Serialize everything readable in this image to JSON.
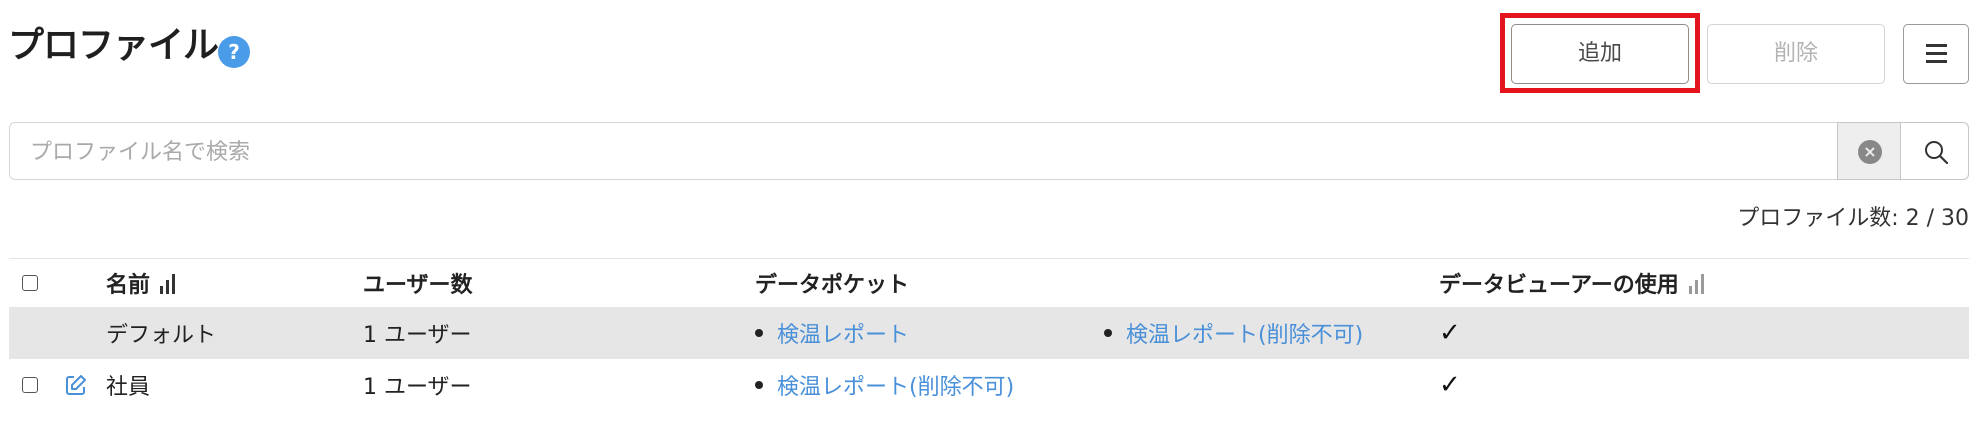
{
  "header": {
    "title": "プロファイル",
    "help_icon": "question-mark-icon",
    "add_label": "追加",
    "delete_label": "削除",
    "menu_icon": "hamburger-menu-icon",
    "highlight_color": "#e3141b"
  },
  "search": {
    "placeholder": "プロファイル名で検索",
    "value": "",
    "clear_icon": "clear-circle-x-icon",
    "search_icon": "magnifier-icon"
  },
  "profile_count": "プロファイル数: 2 / 30",
  "table": {
    "columns": {
      "name": "名前",
      "users": "ユーザー数",
      "data_pocket": "データポケット",
      "data_viewer": "データビューアーの使用"
    },
    "rows": [
      {
        "name": "デフォルト",
        "users": "1 ユーザー",
        "pocket_1": "検温レポート",
        "pocket_2": "検温レポート(削除不可)",
        "viewer": "✓",
        "selected": false
      },
      {
        "name": "社員",
        "users": "1 ユーザー",
        "pocket_1": "検温レポート(削除不可)",
        "viewer": "✓",
        "selected": false
      }
    ]
  },
  "colors": {
    "accent": "#4a9be8",
    "link": "#4a90d9",
    "row_highlight": "#e6e6e6"
  }
}
